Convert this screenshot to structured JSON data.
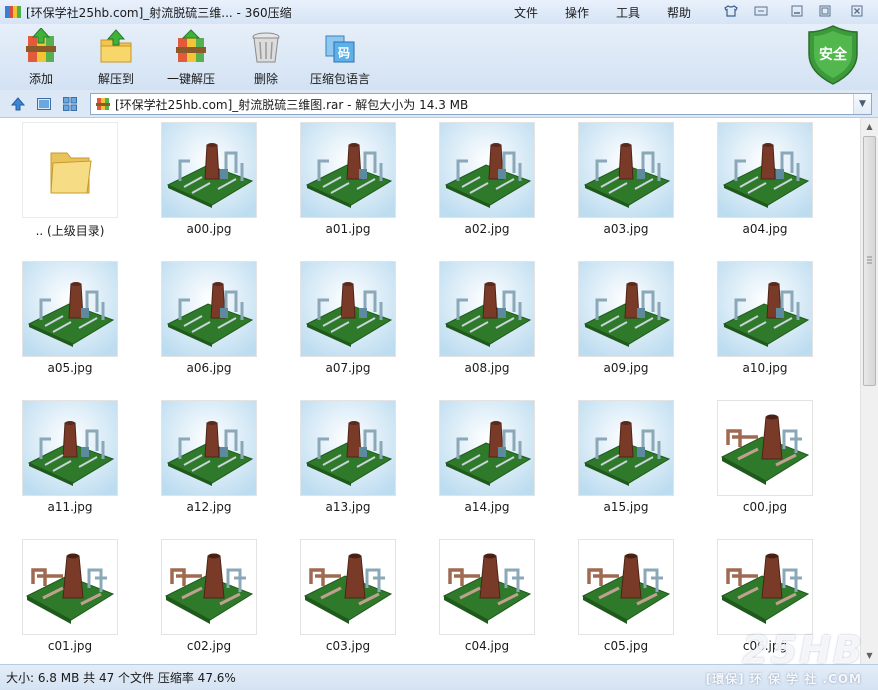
{
  "window": {
    "title": "[环保学社25hb.com]_射流脱硫三维... - 360压缩",
    "logo_icon": "archive-app-icon"
  },
  "menu": [
    "文件",
    "操作",
    "工具",
    "帮助"
  ],
  "window_controls": [
    "skin-icon",
    "feedback-icon",
    "minimize-icon",
    "maximize-icon",
    "close-icon"
  ],
  "toolbar": {
    "buttons": [
      {
        "label": "添加",
        "icon": "add-archive-icon"
      },
      {
        "label": "解压到",
        "icon": "extract-to-icon"
      },
      {
        "label": "一键解压",
        "icon": "one-click-extract-icon"
      },
      {
        "label": "删除",
        "icon": "delete-bin-icon"
      },
      {
        "label": "压缩包语言",
        "icon": "archive-language-icon"
      }
    ],
    "language_icon_text": "码",
    "security_badge": "安全"
  },
  "address": {
    "path": "[环保学社25hb.com]_射流脱硫三维图.rar - 解包大小为 14.3 MB"
  },
  "files": [
    {
      "name": ".. (上级目录)",
      "kind": "folder"
    },
    {
      "name": "a00.jpg",
      "kind": "a"
    },
    {
      "name": "a01.jpg",
      "kind": "a"
    },
    {
      "name": "a02.jpg",
      "kind": "a"
    },
    {
      "name": "a03.jpg",
      "kind": "a"
    },
    {
      "name": "a04.jpg",
      "kind": "a"
    },
    {
      "name": "a05.jpg",
      "kind": "a"
    },
    {
      "name": "a06.jpg",
      "kind": "a"
    },
    {
      "name": "a07.jpg",
      "kind": "a"
    },
    {
      "name": "a08.jpg",
      "kind": "a"
    },
    {
      "name": "a09.jpg",
      "kind": "a"
    },
    {
      "name": "a10.jpg",
      "kind": "a"
    },
    {
      "name": "a11.jpg",
      "kind": "a"
    },
    {
      "name": "a12.jpg",
      "kind": "a"
    },
    {
      "name": "a13.jpg",
      "kind": "a"
    },
    {
      "name": "a14.jpg",
      "kind": "a"
    },
    {
      "name": "a15.jpg",
      "kind": "a"
    },
    {
      "name": "c00.jpg",
      "kind": "c"
    },
    {
      "name": "c01.jpg",
      "kind": "c"
    },
    {
      "name": "c02.jpg",
      "kind": "c"
    },
    {
      "name": "c03.jpg",
      "kind": "c"
    },
    {
      "name": "c04.jpg",
      "kind": "c"
    },
    {
      "name": "c05.jpg",
      "kind": "c"
    },
    {
      "name": "c06.jpg",
      "kind": "c"
    }
  ],
  "status": {
    "text": "大小: 6.8 MB 共 47 个文件 压缩率 47.6%"
  },
  "watermark": {
    "logo": "25HB",
    "tagline": "[環保] 环 保 学 社 .COM"
  },
  "colors": {
    "sky": "#bcdcf0",
    "ground": "#2f7a2a",
    "tower": "#7a3a28",
    "pipe": "#8aa8b8"
  }
}
